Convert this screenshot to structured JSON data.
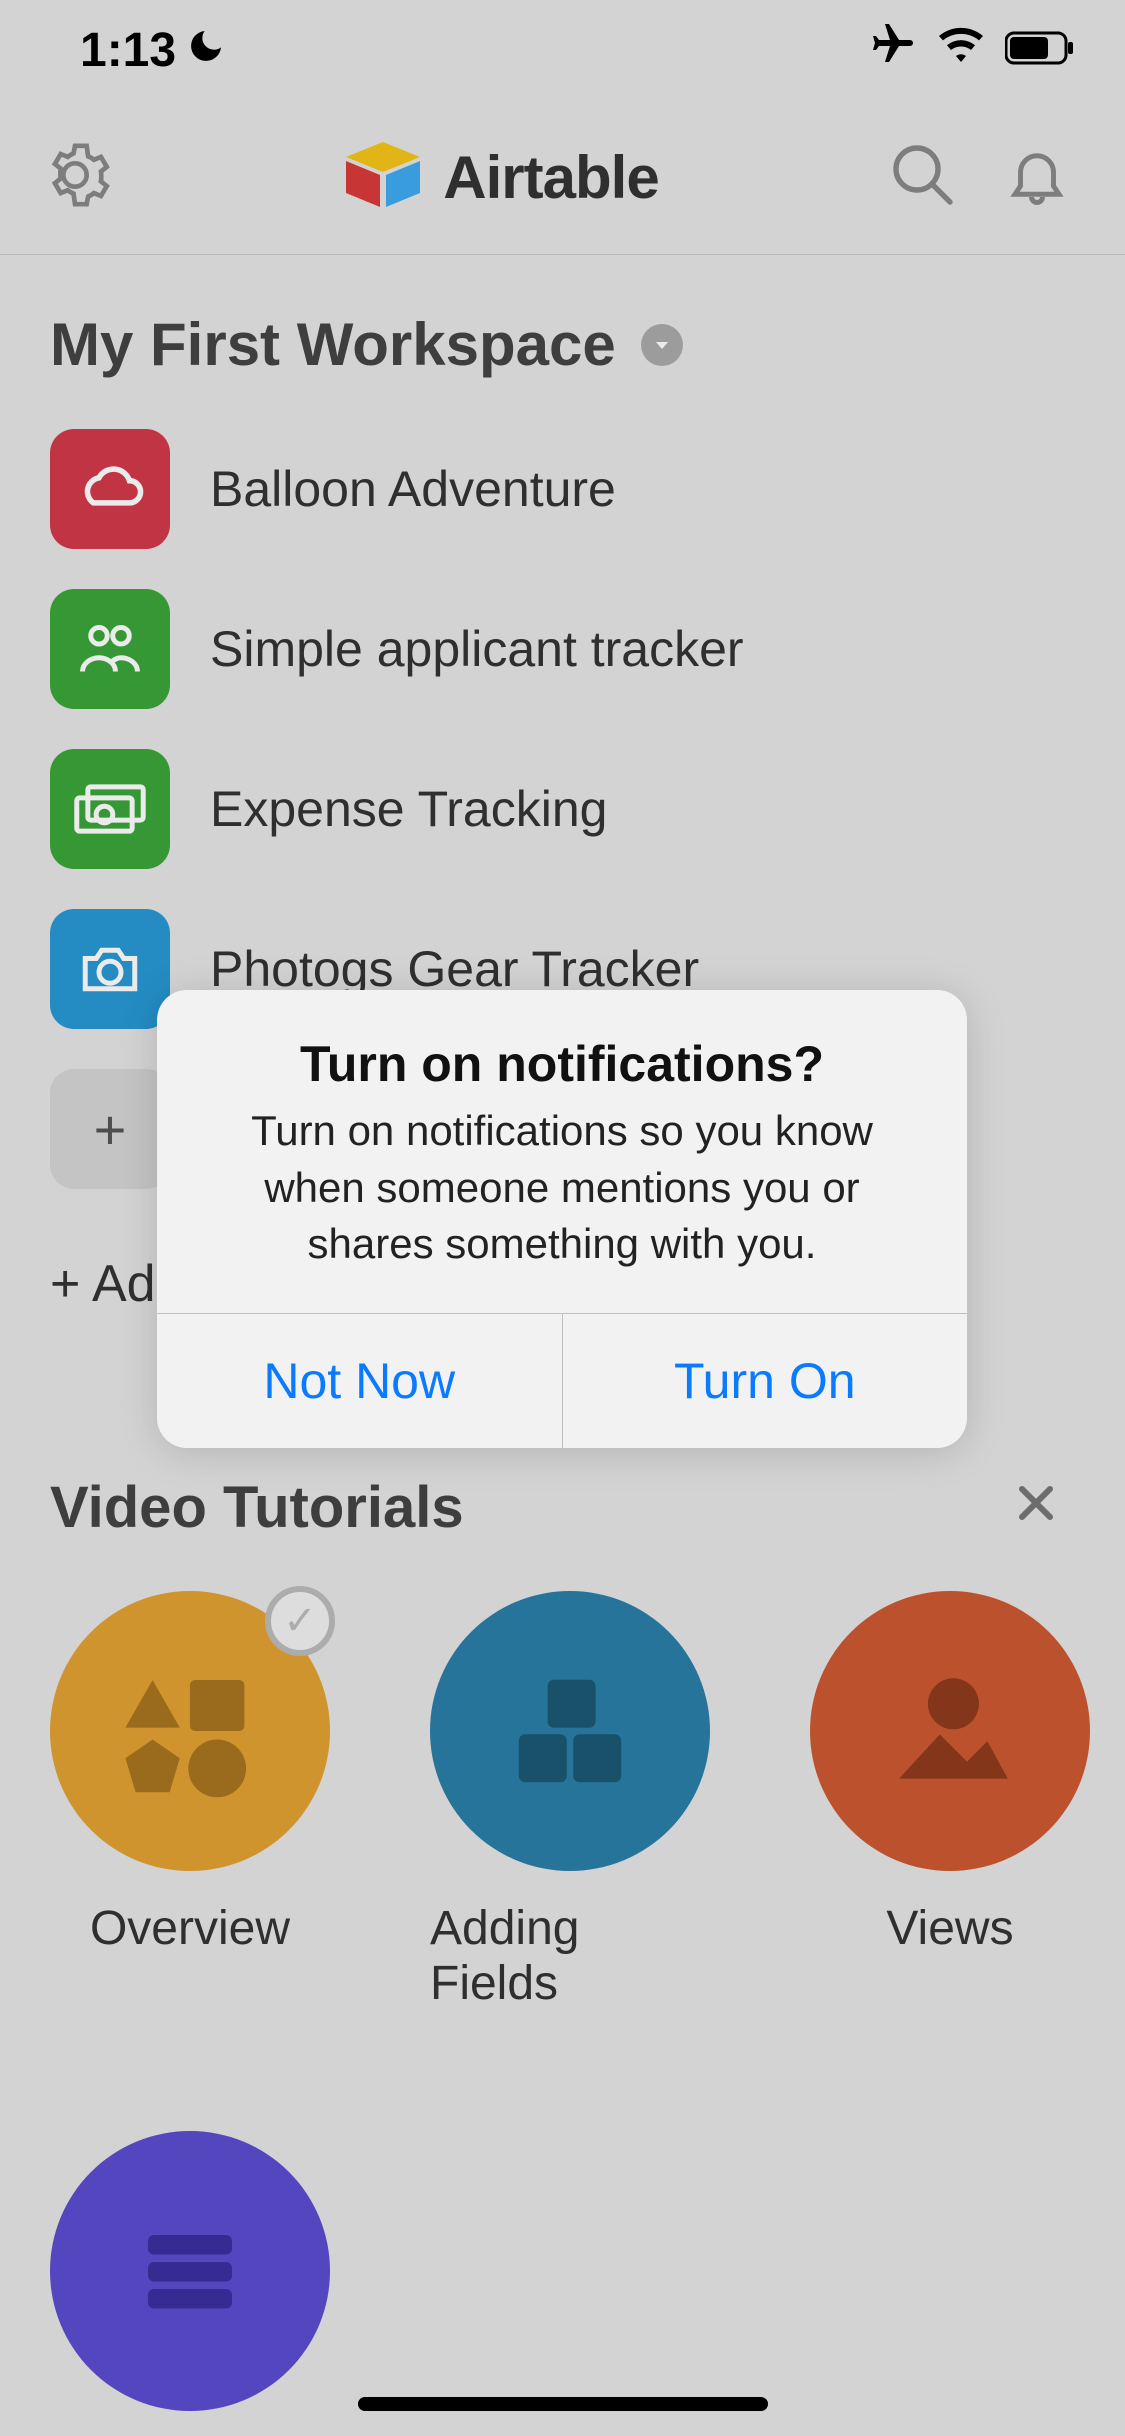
{
  "status": {
    "time": "1:13"
  },
  "header": {
    "app_name": "Airtable"
  },
  "workspace": {
    "title": "My First Workspace",
    "bases": [
      {
        "label": "Balloon Adventure"
      },
      {
        "label": "Simple applicant tracker"
      },
      {
        "label": "Expense Tracking"
      },
      {
        "label": "Photogs Gear Tracker"
      }
    ],
    "add_base_label": "+ Ad"
  },
  "tutorials": {
    "section_title": "Video Tutorials",
    "items": [
      {
        "label": "Overview"
      },
      {
        "label": "Adding Fields"
      },
      {
        "label": "Views"
      }
    ]
  },
  "modal": {
    "title": "Turn on notifications?",
    "message": "Turn on notifications so you know when someone mentions you or shares something with you.",
    "not_now": "Not Now",
    "turn_on": "Turn On"
  }
}
